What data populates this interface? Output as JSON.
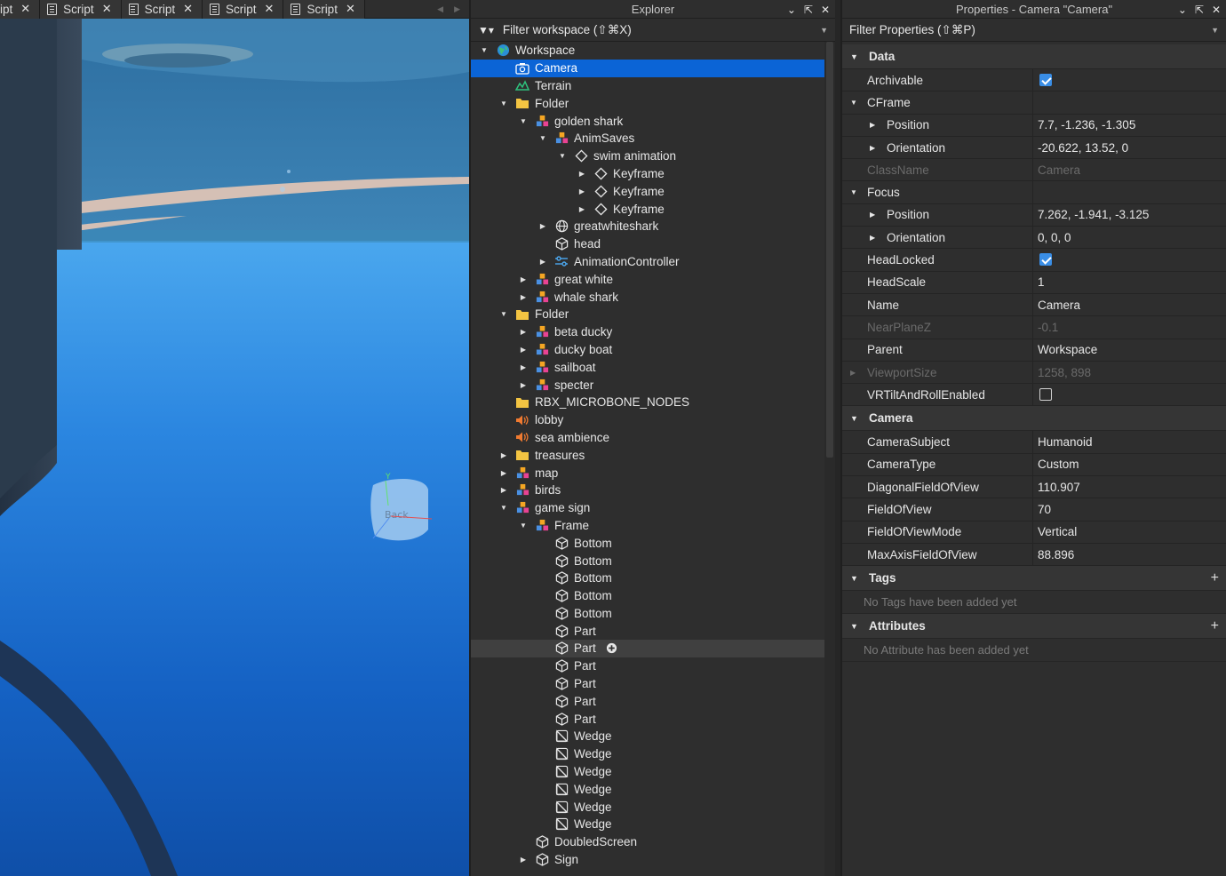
{
  "script_tabs": [
    {
      "label": "ipt"
    },
    {
      "label": "Script"
    },
    {
      "label": "Script"
    },
    {
      "label": "Script"
    },
    {
      "label": "Script"
    }
  ],
  "viewport": {
    "gizmo_label": "Back",
    "gizmo_axis": "Y"
  },
  "explorer": {
    "title": "Explorer",
    "filter_placeholder": "Filter workspace (⇧⌘X)",
    "items": [
      {
        "label": "Workspace",
        "depth": 0,
        "exp": "open",
        "icon": "globe-icon"
      },
      {
        "label": "Camera",
        "depth": 1,
        "exp": "none",
        "icon": "camera-icon",
        "selected": true
      },
      {
        "label": "Terrain",
        "depth": 1,
        "exp": "none",
        "icon": "terrain-icon"
      },
      {
        "label": "Folder",
        "depth": 1,
        "exp": "open",
        "icon": "folder-icon"
      },
      {
        "label": "golden shark",
        "depth": 2,
        "exp": "open",
        "icon": "model-icon"
      },
      {
        "label": "AnimSaves",
        "depth": 3,
        "exp": "open",
        "icon": "model-icon"
      },
      {
        "label": "swim animation",
        "depth": 4,
        "exp": "open",
        "icon": "keyframe-icon"
      },
      {
        "label": "Keyframe",
        "depth": 5,
        "exp": "closed",
        "icon": "keyframe-icon"
      },
      {
        "label": "Keyframe",
        "depth": 5,
        "exp": "closed",
        "icon": "keyframe-icon"
      },
      {
        "label": "Keyframe",
        "depth": 5,
        "exp": "closed",
        "icon": "keyframe-icon"
      },
      {
        "label": "greatwhiteshark",
        "depth": 3,
        "exp": "closed",
        "icon": "mesh-globe-icon"
      },
      {
        "label": "head",
        "depth": 3,
        "exp": "none",
        "icon": "part-icon"
      },
      {
        "label": "AnimationController",
        "depth": 3,
        "exp": "closed",
        "icon": "anim-controller-icon"
      },
      {
        "label": "great white",
        "depth": 2,
        "exp": "closed",
        "icon": "model-icon"
      },
      {
        "label": "whale shark",
        "depth": 2,
        "exp": "closed",
        "icon": "model-icon"
      },
      {
        "label": "Folder",
        "depth": 1,
        "exp": "open",
        "icon": "folder-icon"
      },
      {
        "label": "beta ducky",
        "depth": 2,
        "exp": "closed",
        "icon": "model-icon"
      },
      {
        "label": "ducky boat",
        "depth": 2,
        "exp": "closed",
        "icon": "model-icon"
      },
      {
        "label": "sailboat",
        "depth": 2,
        "exp": "closed",
        "icon": "model-icon"
      },
      {
        "label": "specter",
        "depth": 2,
        "exp": "closed",
        "icon": "model-icon"
      },
      {
        "label": "RBX_MICROBONE_NODES",
        "depth": 1,
        "exp": "none",
        "icon": "folder-icon"
      },
      {
        "label": "lobby",
        "depth": 1,
        "exp": "none",
        "icon": "sound-icon"
      },
      {
        "label": "sea ambience",
        "depth": 1,
        "exp": "none",
        "icon": "sound-icon"
      },
      {
        "label": "treasures",
        "depth": 1,
        "exp": "closed",
        "icon": "folder-icon"
      },
      {
        "label": "map",
        "depth": 1,
        "exp": "closed",
        "icon": "model-icon"
      },
      {
        "label": "birds",
        "depth": 1,
        "exp": "closed",
        "icon": "model-icon"
      },
      {
        "label": "game sign",
        "depth": 1,
        "exp": "open",
        "icon": "model-icon"
      },
      {
        "label": "Frame",
        "depth": 2,
        "exp": "open",
        "icon": "model-icon"
      },
      {
        "label": "Bottom",
        "depth": 3,
        "exp": "none",
        "icon": "part-icon"
      },
      {
        "label": "Bottom",
        "depth": 3,
        "exp": "none",
        "icon": "part-icon"
      },
      {
        "label": "Bottom",
        "depth": 3,
        "exp": "none",
        "icon": "part-icon"
      },
      {
        "label": "Bottom",
        "depth": 3,
        "exp": "none",
        "icon": "part-icon"
      },
      {
        "label": "Bottom",
        "depth": 3,
        "exp": "none",
        "icon": "part-icon"
      },
      {
        "label": "Part",
        "depth": 3,
        "exp": "none",
        "icon": "part-icon"
      },
      {
        "label": "Part",
        "depth": 3,
        "exp": "none",
        "icon": "part-icon",
        "hover": true
      },
      {
        "label": "Part",
        "depth": 3,
        "exp": "none",
        "icon": "part-icon"
      },
      {
        "label": "Part",
        "depth": 3,
        "exp": "none",
        "icon": "part-icon"
      },
      {
        "label": "Part",
        "depth": 3,
        "exp": "none",
        "icon": "part-icon"
      },
      {
        "label": "Part",
        "depth": 3,
        "exp": "none",
        "icon": "part-icon"
      },
      {
        "label": "Wedge",
        "depth": 3,
        "exp": "none",
        "icon": "wedge-icon"
      },
      {
        "label": "Wedge",
        "depth": 3,
        "exp": "none",
        "icon": "wedge-icon"
      },
      {
        "label": "Wedge",
        "depth": 3,
        "exp": "none",
        "icon": "wedge-icon"
      },
      {
        "label": "Wedge",
        "depth": 3,
        "exp": "none",
        "icon": "wedge-icon"
      },
      {
        "label": "Wedge",
        "depth": 3,
        "exp": "none",
        "icon": "wedge-icon"
      },
      {
        "label": "Wedge",
        "depth": 3,
        "exp": "none",
        "icon": "wedge-icon"
      },
      {
        "label": "DoubledScreen",
        "depth": 2,
        "exp": "none",
        "icon": "part-icon"
      },
      {
        "label": "Sign",
        "depth": 2,
        "exp": "closed",
        "icon": "part-icon"
      }
    ]
  },
  "properties": {
    "title": "Properties - Camera \"Camera\"",
    "filter_placeholder": "Filter Properties (⇧⌘P)",
    "sections": [
      {
        "title": "Data",
        "rows": [
          {
            "name": "Archivable",
            "type": "check",
            "value": true
          },
          {
            "name": "CFrame",
            "type": "group",
            "value": ""
          },
          {
            "name": "Position",
            "type": "text",
            "value": "7.7, -1.236, -1.305",
            "sub": true
          },
          {
            "name": "Orientation",
            "type": "text",
            "value": "-20.622, 13.52, 0",
            "sub": true
          },
          {
            "name": "ClassName",
            "type": "text",
            "value": "Camera",
            "dim": true
          },
          {
            "name": "Focus",
            "type": "group",
            "value": ""
          },
          {
            "name": "Position",
            "type": "text",
            "value": "7.262, -1.941, -3.125",
            "sub": true
          },
          {
            "name": "Orientation",
            "type": "text",
            "value": "0, 0, 0",
            "sub": true
          },
          {
            "name": "HeadLocked",
            "type": "check",
            "value": true
          },
          {
            "name": "HeadScale",
            "type": "text",
            "value": "1"
          },
          {
            "name": "Name",
            "type": "text",
            "value": "Camera"
          },
          {
            "name": "NearPlaneZ",
            "type": "text",
            "value": "-0.1",
            "dim": true
          },
          {
            "name": "Parent",
            "type": "text",
            "value": "Workspace"
          },
          {
            "name": "ViewportSize",
            "type": "text",
            "value": "1258, 898",
            "dim": true,
            "collapsible": true
          },
          {
            "name": "VRTiltAndRollEnabled",
            "type": "check",
            "value": false
          }
        ]
      },
      {
        "title": "Camera",
        "rows": [
          {
            "name": "CameraSubject",
            "type": "text",
            "value": "Humanoid"
          },
          {
            "name": "CameraType",
            "type": "text",
            "value": "Custom"
          },
          {
            "name": "DiagonalFieldOfView",
            "type": "text",
            "value": "110.907"
          },
          {
            "name": "FieldOfView",
            "type": "text",
            "value": "70"
          },
          {
            "name": "FieldOfViewMode",
            "type": "text",
            "value": "Vertical"
          },
          {
            "name": "MaxAxisFieldOfView",
            "type": "text",
            "value": "88.896"
          }
        ]
      },
      {
        "title": "Tags",
        "plus": true,
        "empty": "No Tags have been added yet",
        "rows": []
      },
      {
        "title": "Attributes",
        "plus": true,
        "empty": "No Attribute has been added yet",
        "rows": []
      }
    ]
  }
}
